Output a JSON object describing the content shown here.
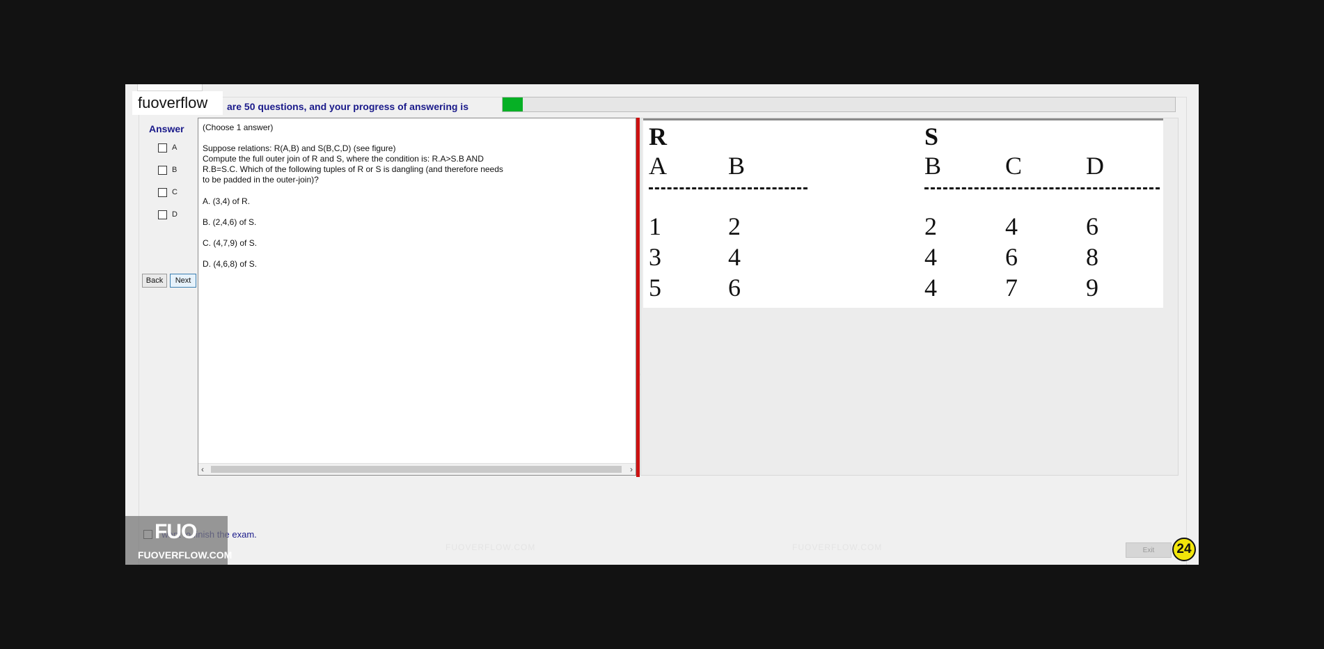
{
  "brand": {
    "label": "fuoverflow"
  },
  "progress": {
    "text": "are 50 questions, and your progress of answering is",
    "fraction": 0.03
  },
  "answer": {
    "label": "Answer",
    "options": [
      "A",
      "B",
      "C",
      "D"
    ]
  },
  "nav": {
    "back_label": "Back",
    "next_label": "Next"
  },
  "question": {
    "choose": "(Choose 1 answer)",
    "lines": [
      "Suppose relations: R(A,B) and S(B,C,D) (see figure)",
      "Compute the full outer join of R and S, where the condition is: R.A>S.B AND",
      "R.B=S.C. Which of the following tuples of R or S is dangling (and therefore needs",
      "to be padded in the outer-join)?"
    ],
    "options": [
      "A.  (3,4) of R.",
      "B.  (2,4,6) of S.",
      "C.  (4,7,9) of S.",
      "D.  (4,6,8) of S."
    ]
  },
  "figure": {
    "r_name": "R",
    "r_cols": [
      "A",
      "B"
    ],
    "r_rows": [
      [
        "1",
        "2"
      ],
      [
        "3",
        "4"
      ],
      [
        "5",
        "6"
      ]
    ],
    "s_name": "S",
    "s_cols": [
      "B",
      "C",
      "D"
    ],
    "s_rows": [
      [
        "2",
        "4",
        "6"
      ],
      [
        "4",
        "6",
        "8"
      ],
      [
        "4",
        "7",
        "9"
      ]
    ]
  },
  "finish": {
    "label": "I want to finish the exam."
  },
  "exit": {
    "label": "Exit"
  },
  "badge": {
    "value": "24"
  },
  "logo": {
    "mark": "FUO",
    "domain": "FUOVERFLOW.COM"
  },
  "watermark": {
    "text": "FUOVERFLOW.COM"
  },
  "colors": {
    "progress_fill": "#06b025",
    "splitter": "#cc1111",
    "badge": "#f2e60a",
    "heading": "#1a1a8a"
  }
}
